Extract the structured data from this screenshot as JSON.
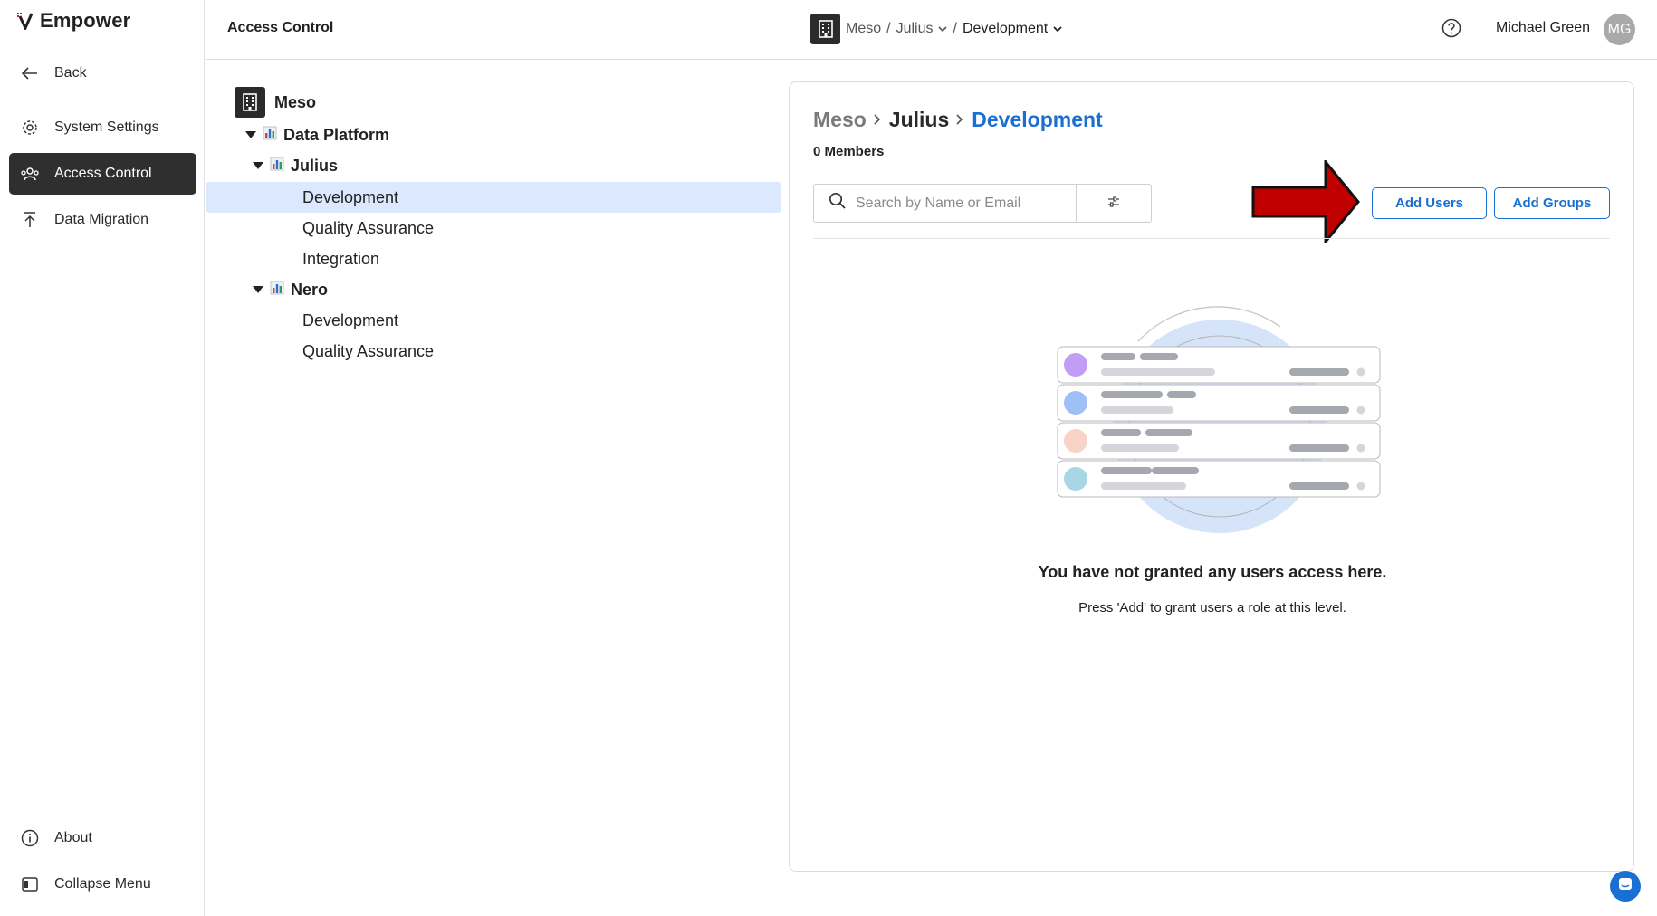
{
  "app": {
    "name": "Empower"
  },
  "sidebar": {
    "back": "Back",
    "items": [
      {
        "label": "System Settings",
        "icon": "gear-icon"
      },
      {
        "label": "Access Control",
        "icon": "access-icon",
        "active": true
      },
      {
        "label": "Data Migration",
        "icon": "upload-icon"
      }
    ],
    "about": "About",
    "collapse": "Collapse Menu"
  },
  "topbar": {
    "title": "Access Control",
    "crumb": {
      "org": "Meso",
      "sep1": "/",
      "project": "Julius",
      "sep2": "/",
      "env": "Development"
    },
    "user": {
      "name": "Michael Green",
      "initials": "MG"
    }
  },
  "tree": {
    "root": "Meso",
    "groups": [
      {
        "label": "Data Platform"
      },
      {
        "label": "Julius",
        "children": [
          "Development",
          "Quality Assurance",
          "Integration"
        ]
      },
      {
        "label": "Nero",
        "children": [
          "Development",
          "Quality Assurance"
        ]
      }
    ],
    "selected": "Julius / Development"
  },
  "panel": {
    "breadcrumb": [
      "Meso",
      "Julius",
      "Development"
    ],
    "members": "0 Members",
    "search": {
      "placeholder": "Search by Name or Email"
    },
    "add_users": "Add Users",
    "add_groups": "Add Groups",
    "empty_title": "You have not granted any users access here.",
    "empty_sub": "Press 'Add' to grant users a role at this level."
  },
  "colors": {
    "accent": "#1a6fd3",
    "selected_row": "#dbe8fd",
    "active_nav": "#2f2f2f",
    "annotation_arrow": "#c00000"
  }
}
